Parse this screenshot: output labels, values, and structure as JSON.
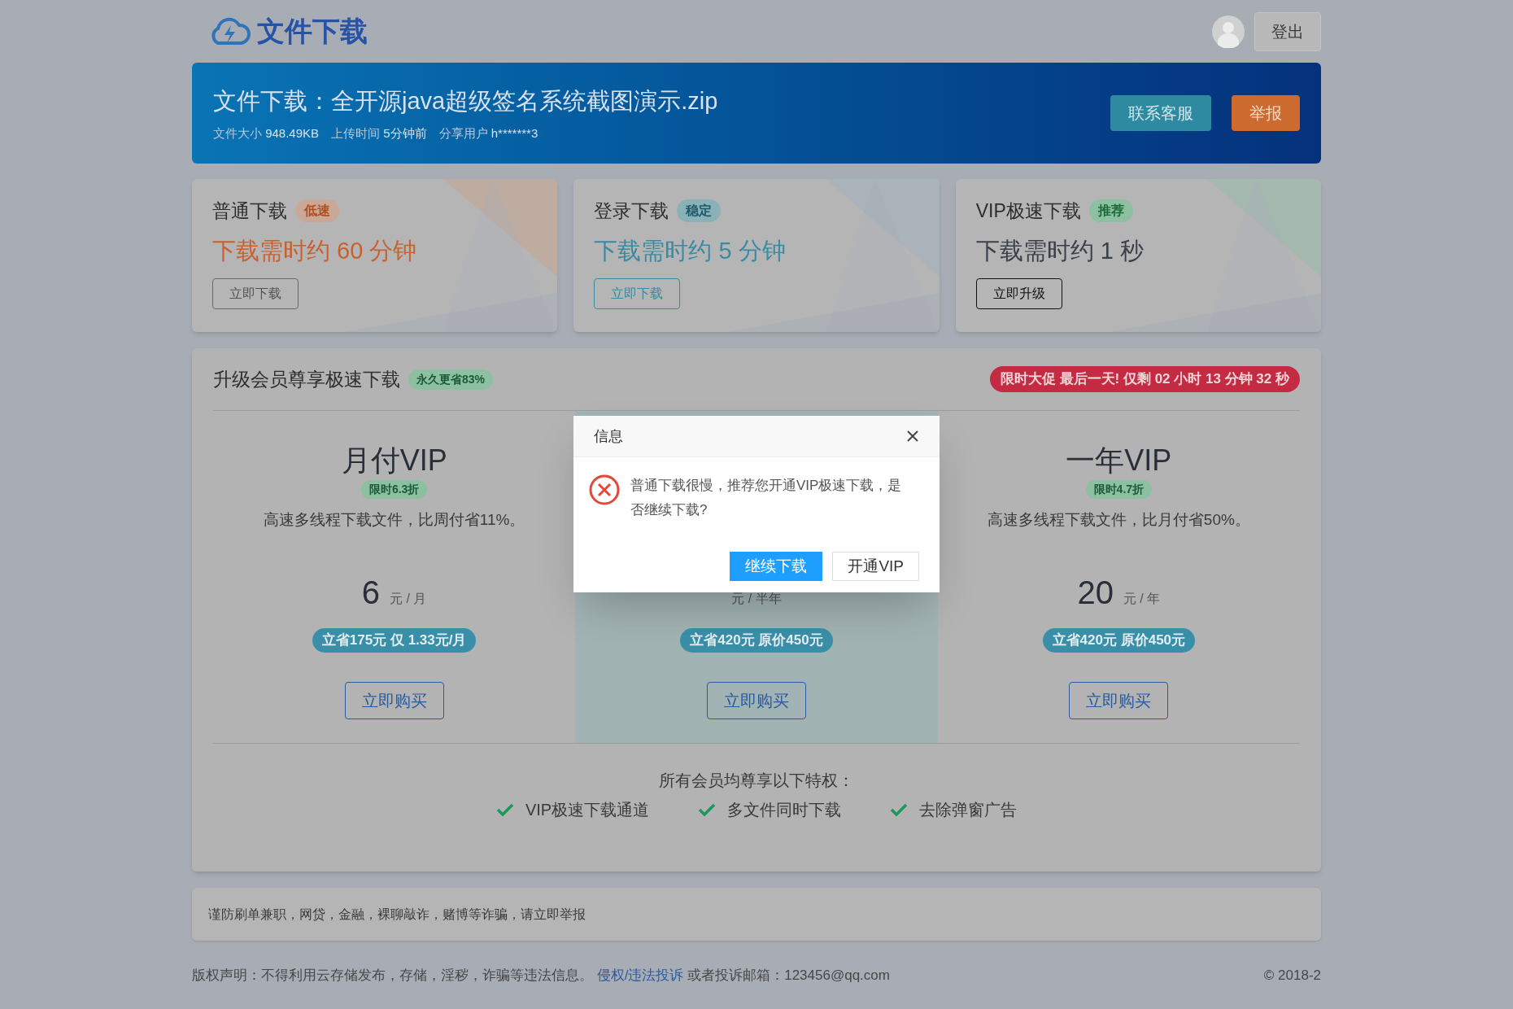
{
  "header": {
    "logo_text": "文件下载",
    "logout": "登出"
  },
  "banner": {
    "title": "文件下载：全开源java超级签名系统截图演示.zip",
    "meta": [
      {
        "label": "文件大小",
        "value": "948.49KB"
      },
      {
        "label": "上传时间",
        "value": "5分钟前"
      },
      {
        "label": "分享用户",
        "value": "h*******3"
      }
    ],
    "buttons": [
      {
        "label": "联系客服",
        "kind": "service"
      },
      {
        "label": "举报",
        "kind": "report"
      }
    ]
  },
  "download_cards": [
    {
      "kind": "slow",
      "title": "普通下载",
      "tag": "低速",
      "time": "下载需时约 60 分钟",
      "button": "立即下载"
    },
    {
      "kind": "stable",
      "title": "登录下载",
      "tag": "稳定",
      "time": "下载需时约 5 分钟",
      "button": "立即下载"
    },
    {
      "kind": "vip",
      "title": "VIP极速下载",
      "tag": "推荐",
      "time": "下载需时约 1 秒",
      "button": "立即升级"
    }
  ],
  "vip_section": {
    "title": "升级会员尊享极速下载",
    "badge": "永久更省83%",
    "promo": "限时大促 最后一天! 仅剩 02 小时 13 分钟 32 秒",
    "plans": [
      {
        "selected": false,
        "name": "月付VIP",
        "discount": "限时6.3折",
        "description": "高速多线程下载文件，比周付省11%。",
        "price": "6",
        "unit": "元 / 月",
        "saving": "立省175元 仅 1.33元/月",
        "button": "立即购买"
      },
      {
        "selected": true,
        "unit": "元 / 半年",
        "saving": "立省420元 原价450元",
        "button": "立即购买"
      },
      {
        "selected": false,
        "name": "一年VIP",
        "discount": "限时4.7折",
        "description": "高速多线程下载文件，比月付省50%。",
        "price": "20",
        "unit": "元 / 年",
        "saving": "立省420元 原价450元",
        "button": "立即购买"
      }
    ],
    "perks_title": "所有会员均尊享以下特权：",
    "perks": [
      "VIP极速下载通道",
      "多文件同时下载",
      "去除弹窗广告"
    ]
  },
  "warning": "谨防刷单兼职，网贷，金融，裸聊敲诈，赌博等诈骗，请立即举报",
  "footer": {
    "text_before": "版权声明：不得利用云存储发布，存储，淫秽，诈骗等违法信息。",
    "link": "侵权/违法投诉",
    "text_after": "或者投诉邮箱：123456@qq.com",
    "copyright": "© 2018-2"
  },
  "dialog": {
    "title": "信息",
    "message": "普通下载很慢，推荐您开通VIP极速下载，是否继续下载?",
    "buttons": [
      {
        "label": "继续下载",
        "kind": "primary"
      },
      {
        "label": "开通VIP",
        "kind": "secondary"
      }
    ]
  }
}
